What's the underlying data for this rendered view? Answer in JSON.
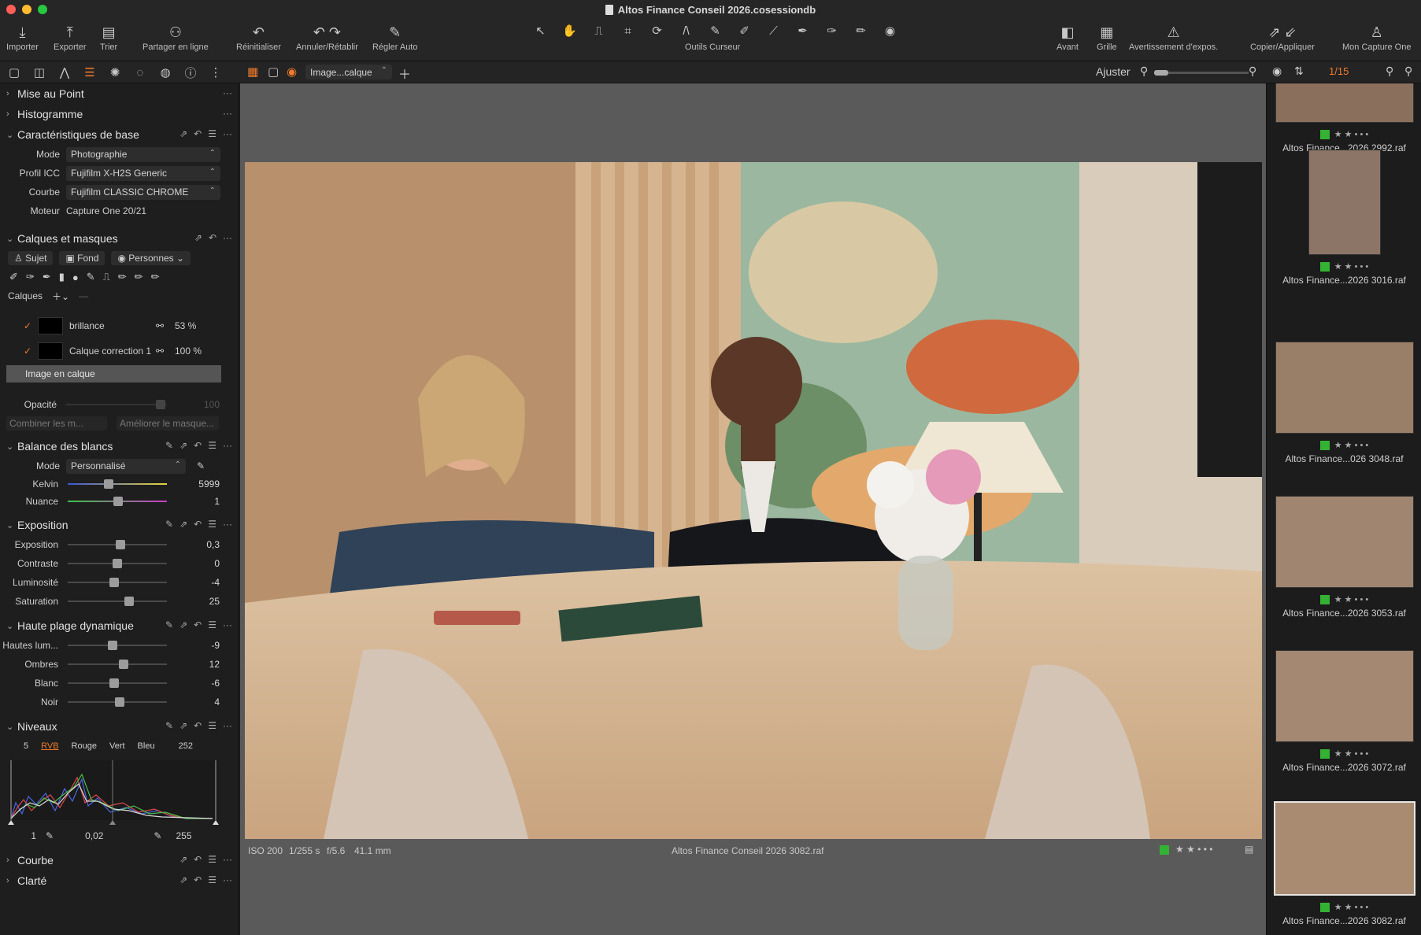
{
  "window": {
    "title": "Altos Finance Conseil 2026.cosessiondb"
  },
  "toolbar": {
    "buttons": [
      {
        "label": "Importer"
      },
      {
        "label": "Exporter"
      },
      {
        "label": "Trier"
      },
      {
        "label": "Partager en ligne"
      },
      {
        "label": "Réinitialiser"
      },
      {
        "label": "Annuler/Rétablir"
      },
      {
        "label": "Régler Auto"
      }
    ],
    "cursor_tools_label": "Outils Curseur",
    "right_buttons": [
      {
        "label": "Avant"
      },
      {
        "label": "Grille"
      },
      {
        "label": "Avertissement d'expos."
      },
      {
        "label": "Copier/Appliquer"
      },
      {
        "label": "Mon Capture One"
      }
    ]
  },
  "viewer_bar": {
    "layer_select": "Image...calque",
    "zoom_label": "Ajuster",
    "counter": "1/15"
  },
  "panels": {
    "focus": {
      "title": "Mise au Point"
    },
    "histogram": {
      "title": "Histogramme"
    },
    "basic": {
      "title": "Caractéristiques de base",
      "mode_label": "Mode",
      "mode_value": "Photographie",
      "icc_label": "Profil ICC",
      "icc_value": "Fujifilm X-H2S Generic",
      "curve_label": "Courbe",
      "curve_value": "Fujifilm CLASSIC CHROME",
      "engine_label": "Moteur",
      "engine_value": "Capture One 20/21"
    },
    "layers": {
      "title": "Calques et masques",
      "chips": [
        "Sujet",
        "Fond",
        "Personnes"
      ],
      "calques_label": "Calques",
      "items": [
        {
          "name": "brillance",
          "opacity": "53 %"
        },
        {
          "name": "Calque correction 1",
          "opacity": "100 %"
        }
      ],
      "background_layer": "Image en calque",
      "opacity_label": "Opacité",
      "opacity_value": "100",
      "combine_btn": "Combiner les m...",
      "refine_btn": "Améliorer le masque..."
    },
    "white_balance": {
      "title": "Balance des blancs",
      "mode_label": "Mode",
      "mode_value": "Personnalisé",
      "kelvin_label": "Kelvin",
      "kelvin_value": "5999",
      "tint_label": "Nuance",
      "tint_value": "1"
    },
    "exposure": {
      "title": "Exposition",
      "rows": [
        {
          "label": "Exposition",
          "value": "0,3",
          "pos": 0.53
        },
        {
          "label": "Contraste",
          "value": "0",
          "pos": 0.5
        },
        {
          "label": "Luminosité",
          "value": "-4",
          "pos": 0.47
        },
        {
          "label": "Saturation",
          "value": "25",
          "pos": 0.62
        }
      ]
    },
    "hdr": {
      "title": "Haute plage dynamique",
      "rows": [
        {
          "label": "Hautes lum...",
          "value": "-9",
          "pos": 0.45
        },
        {
          "label": "Ombres",
          "value": "12",
          "pos": 0.56
        },
        {
          "label": "Blanc",
          "value": "-6",
          "pos": 0.47
        },
        {
          "label": "Noir",
          "value": "4",
          "pos": 0.52
        }
      ]
    },
    "levels": {
      "title": "Niveaux",
      "channels": [
        "RVB",
        "Rouge",
        "Vert",
        "Bleu"
      ],
      "active_channel": "RVB",
      "input_low": "5",
      "input_high": "252",
      "output_low": "1",
      "gamma": "0,02",
      "output_high": "255"
    },
    "curve": {
      "title": "Courbe"
    },
    "clarity": {
      "title": "Clarté"
    }
  },
  "viewer": {
    "iso": "ISO 200",
    "shutter": "1/255 s",
    "aperture": "f/5.6",
    "focal": "41.1 mm",
    "filename": "Altos Finance Conseil 2026 3082.raf"
  },
  "browser": {
    "items": [
      {
        "name": "Altos Finance...2026 2992.raf",
        "rating": "★ ★ • • •"
      },
      {
        "name": "Altos Finance...2026 3016.raf",
        "rating": "★ ★ • • •"
      },
      {
        "name": "Altos Finance...026 3048.raf",
        "rating": "★ ★ • • •"
      },
      {
        "name": "Altos Finance...2026 3053.raf",
        "rating": "★ ★ • • •"
      },
      {
        "name": "Altos Finance...2026 3072.raf",
        "rating": "★ ★ • • •"
      },
      {
        "name": "Altos Finance...2026 3082.raf",
        "rating": "★ ★ • • •"
      }
    ]
  },
  "colors": {
    "accent": "#f07b2c",
    "tag_green": "#34b233"
  }
}
